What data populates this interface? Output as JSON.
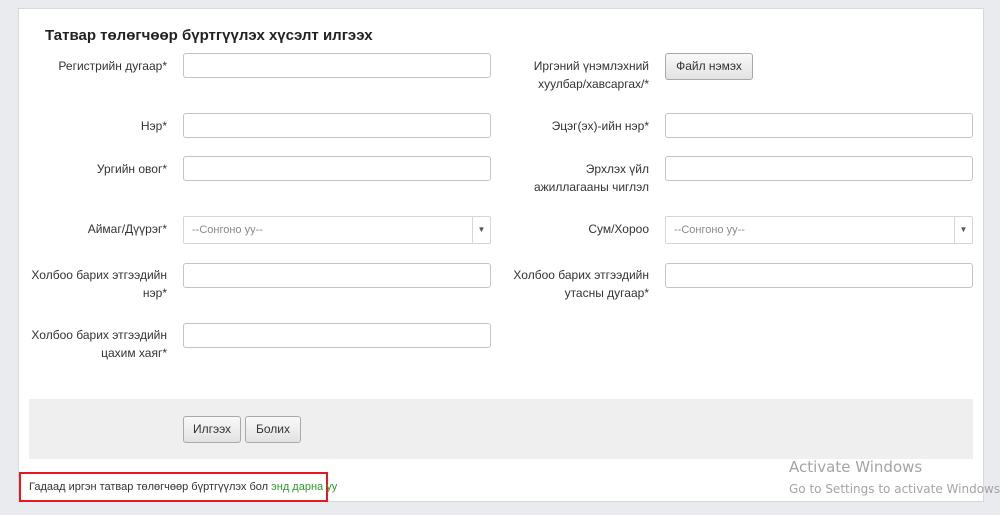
{
  "form": {
    "title": "Татвар төлөгчөөр бүртгүүлэх хүсэлт илгээх",
    "register_label": "Регистрийн дугаар*",
    "register_value": "",
    "first_name_label": "Нэр*",
    "first_name_value": "",
    "clan_label": "Ургийн овог*",
    "clan_value": "",
    "province_label": "Аймаг/Дүүрэг*",
    "province_selected": "--Сонгоно уу--",
    "contact_name_label_1": "Холбоо барих этгээдийн",
    "contact_name_label_2": "нэр*",
    "contact_name_value": "",
    "contact_email_label_1": "Холбоо барих этгээдийн",
    "contact_email_label_2": "цахим хаяг*",
    "contact_email_value": "",
    "id_copy_label_1": "Иргэний үнэмлэхний",
    "id_copy_label_2": "хуулбар/хавсаргах/*",
    "file_add_button": "Файл нэмэх",
    "father_name_label": "Эцэг(эх)-ийн нэр*",
    "father_name_value": "",
    "activity_label_1": "Эрхлэх үйл",
    "activity_label_2": "ажиллагааны чиглэл",
    "activity_value": "",
    "district_label": "Сум/Хороо",
    "district_selected": "--Сонгоно уу--",
    "contact_phone_label_1": "Холбоо барих этгээдийн",
    "contact_phone_label_2": "утасны дугаар*",
    "contact_phone_value": "",
    "submit_button": "Илгээх",
    "cancel_button": "Болих"
  },
  "notice": {
    "text": "Гадаад иргэн татвар төлөгчөөр бүртгүүлэх бол ",
    "link_text": "энд дарна уу"
  },
  "watermark": {
    "line1": "Activate Windows",
    "line2": "Go to Settings to activate Windows."
  },
  "icons": {
    "dropdown_caret": "▼"
  }
}
